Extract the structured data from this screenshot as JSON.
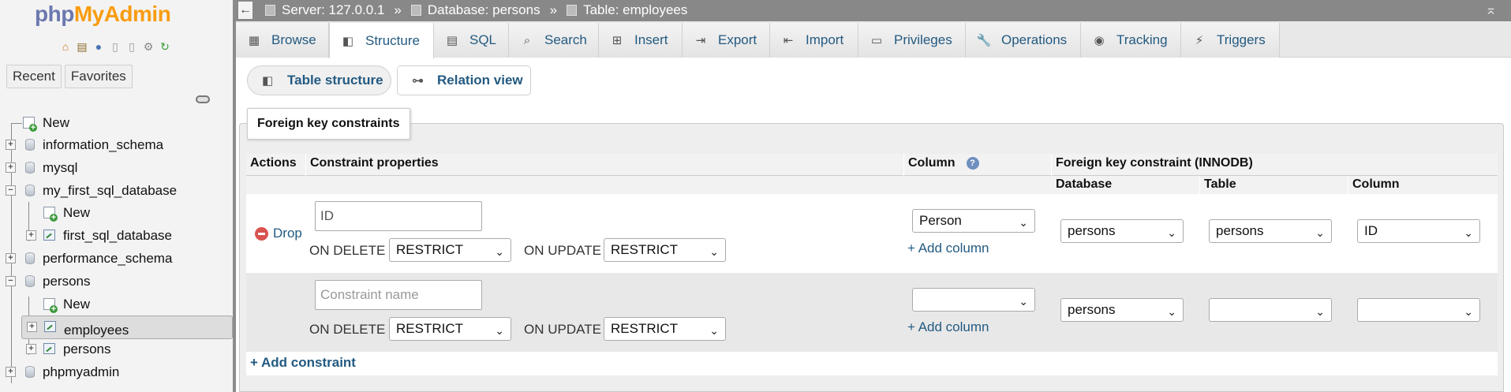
{
  "logo": {
    "part1": "php",
    "part2": "MyAdmin"
  },
  "nav": {
    "tabs": [
      "Recent",
      "Favorites"
    ],
    "tree": [
      {
        "label": "New",
        "kind": "new"
      },
      {
        "label": "information_schema",
        "kind": "db"
      },
      {
        "label": "mysql",
        "kind": "db"
      },
      {
        "label": "my_first_sql_database",
        "kind": "db"
      },
      {
        "label": "New",
        "kind": "new"
      },
      {
        "label": "first_sql_database",
        "kind": "table"
      },
      {
        "label": "performance_schema",
        "kind": "db"
      },
      {
        "label": "persons",
        "kind": "db"
      },
      {
        "label": "New",
        "kind": "new"
      },
      {
        "label": "employees",
        "kind": "table",
        "selected": true
      },
      {
        "label": "persons",
        "kind": "table"
      },
      {
        "label": "phpmyadmin",
        "kind": "db"
      }
    ]
  },
  "breadcrumb": {
    "server": "Server: 127.0.0.1",
    "database": "Database: persons",
    "table": "Table: employees",
    "separator": "»"
  },
  "tabs": [
    "Browse",
    "Structure",
    "SQL",
    "Search",
    "Insert",
    "Export",
    "Import",
    "Privileges",
    "Operations",
    "Tracking",
    "Triggers"
  ],
  "subtabs": [
    "Table structure",
    "Relation view"
  ],
  "fieldset_legend": "Foreign key constraints",
  "table": {
    "headers": {
      "actions": "Actions",
      "constraint_properties": "Constraint properties",
      "column": "Column",
      "fk_group": "Foreign key constraint (INNODB)",
      "database": "Database",
      "table": "Table",
      "ref_column": "Column"
    },
    "rows": [
      {
        "drop_label": "Drop",
        "name_value": "ID",
        "on_delete_label": "ON DELETE",
        "on_delete": "RESTRICT",
        "on_update_label": "ON UPDATE",
        "on_update": "RESTRICT",
        "column": "Person",
        "add_column": "+ Add column",
        "ref_database": "persons",
        "ref_table": "persons",
        "ref_column": "ID"
      },
      {
        "name_placeholder": "Constraint name",
        "on_delete_label": "ON DELETE",
        "on_delete": "RESTRICT",
        "on_update_label": "ON UPDATE",
        "on_update": "RESTRICT",
        "column": "",
        "add_column": "+ Add column",
        "ref_database": "persons",
        "ref_table": "",
        "ref_column": ""
      }
    ],
    "add_constraint": "+ Add constraint"
  }
}
